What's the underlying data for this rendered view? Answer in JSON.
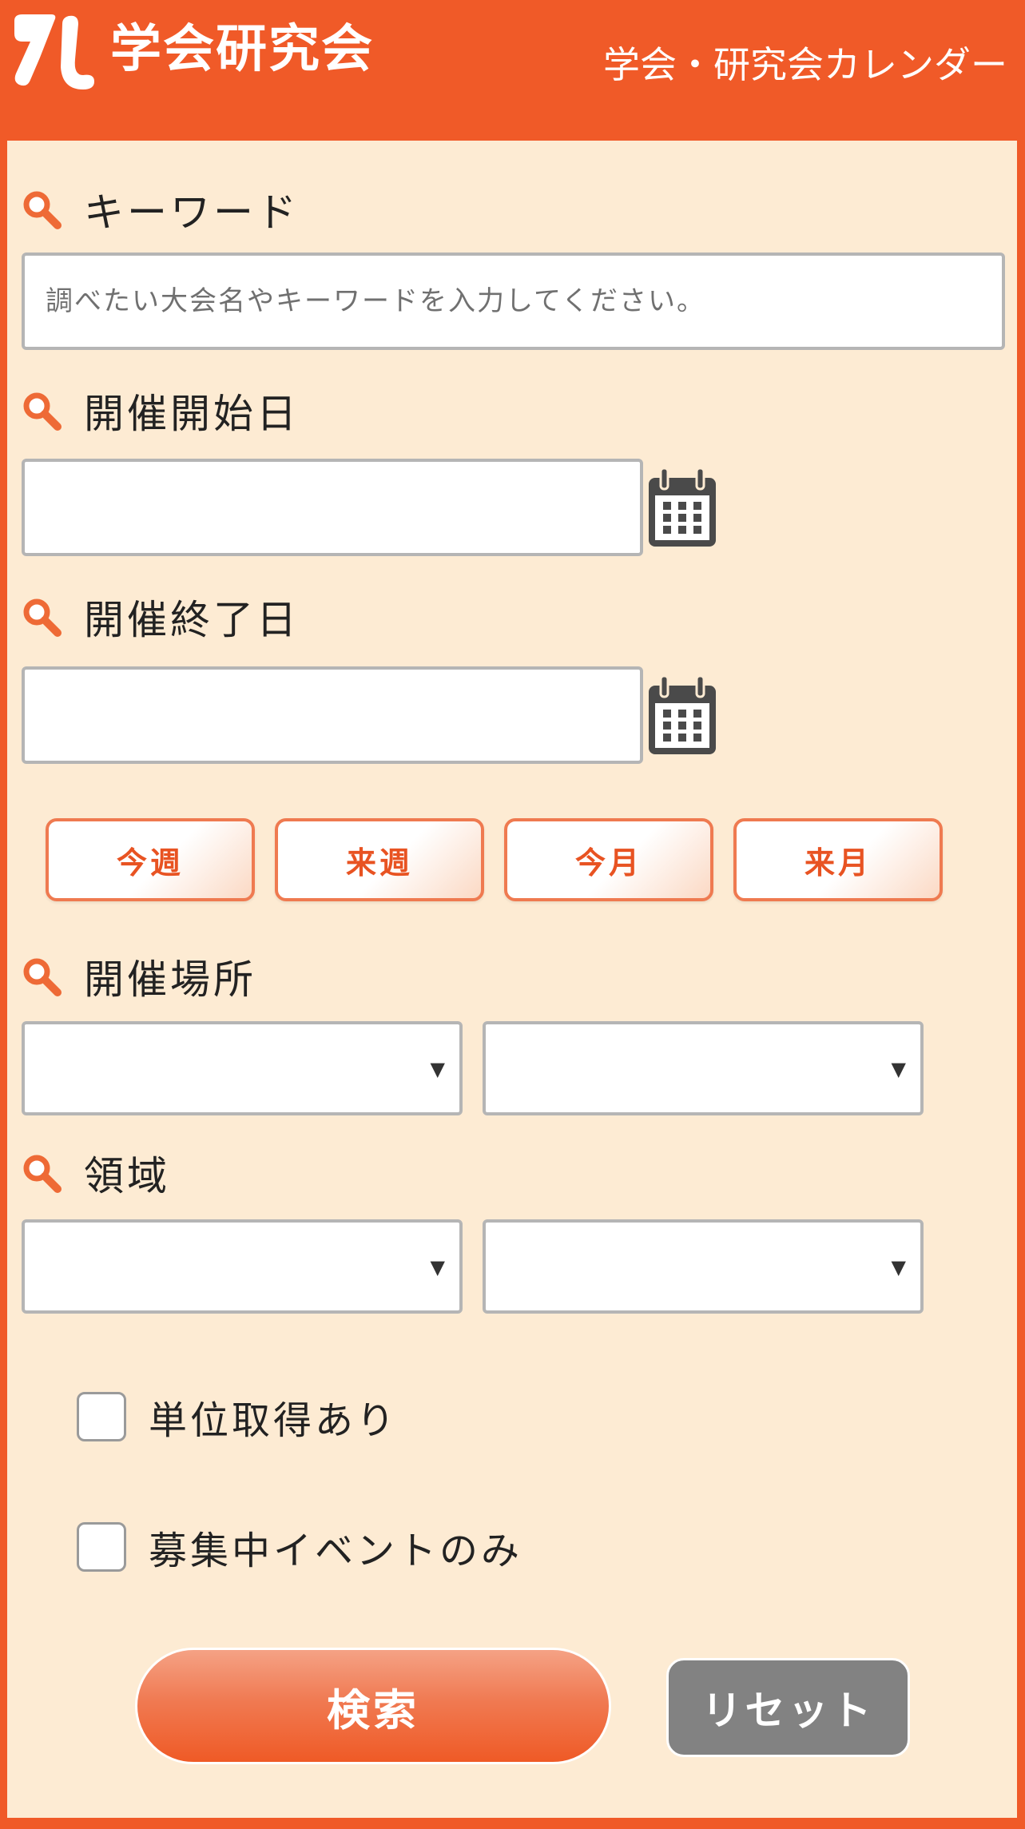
{
  "header": {
    "logo_text": "学会研究会",
    "title": "学会・研究会カレンダー"
  },
  "form": {
    "keyword": {
      "label": "キーワード",
      "placeholder": "調べたい大会名やキーワードを入力してください。",
      "value": ""
    },
    "start_date": {
      "label": "開催開始日",
      "value": ""
    },
    "end_date": {
      "label": "開催終了日",
      "value": ""
    },
    "range_buttons": [
      "今週",
      "来週",
      "今月",
      "来月"
    ],
    "location": {
      "label": "開催場所",
      "select1_value": "",
      "select2_value": ""
    },
    "field": {
      "label": "領域",
      "select1_value": "",
      "select2_value": ""
    },
    "checkboxes": [
      {
        "label": "単位取得あり",
        "checked": false
      },
      {
        "label": "募集中イベントのみ",
        "checked": false
      }
    ],
    "search_label": "検索",
    "reset_label": "リセット"
  },
  "icons": {
    "label_icon": "magnifier-icon",
    "date_picker_icon": "calendar-icon",
    "select_icon": "dropdown-arrow-icon"
  },
  "colors": {
    "brand": "#f05a28",
    "panel_bg": "#fdebd3",
    "reset_gray": "#828282"
  }
}
